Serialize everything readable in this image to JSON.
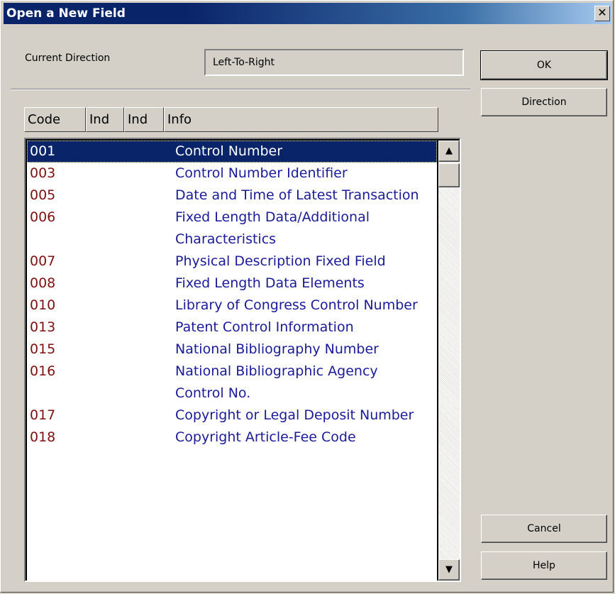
{
  "window": {
    "title": "Open a New Field",
    "close_glyph": "✕"
  },
  "direction": {
    "label": "Current Direction",
    "value": "Left-To-Right"
  },
  "buttons": {
    "ok": "OK",
    "direction": "Direction",
    "cancel": "Cancel",
    "help": "Help"
  },
  "list": {
    "columns": [
      "Code",
      "Ind",
      "Ind",
      "Info"
    ],
    "selected_index": 0,
    "rows": [
      {
        "code": "001",
        "info": "Control Number"
      },
      {
        "code": "003",
        "info": "Control Number Identifier"
      },
      {
        "code": "005",
        "info": "Date and Time of Latest Transaction"
      },
      {
        "code": "006",
        "info": "Fixed Length Data/Additional Characteristics"
      },
      {
        "code": "007",
        "info": "Physical Description Fixed Field"
      },
      {
        "code": "008",
        "info": "Fixed Length Data Elements"
      },
      {
        "code": "010",
        "info": "Library of Congress Control Number"
      },
      {
        "code": "013",
        "info": "Patent Control Information"
      },
      {
        "code": "015",
        "info": "National Bibliography Number"
      },
      {
        "code": "016",
        "info": "National Bibliographic Agency Control No."
      },
      {
        "code": "017",
        "info": "Copyright or Legal Deposit Number"
      },
      {
        "code": "018",
        "info": "Copyright Article-Fee Code"
      }
    ]
  },
  "scrollbar": {
    "up_glyph": "▲",
    "down_glyph": "▼"
  },
  "colors": {
    "titlebar": "#0a246a",
    "code_text": "#7f1010",
    "info_text": "#1a1a9a",
    "selection": "#0a246a"
  }
}
